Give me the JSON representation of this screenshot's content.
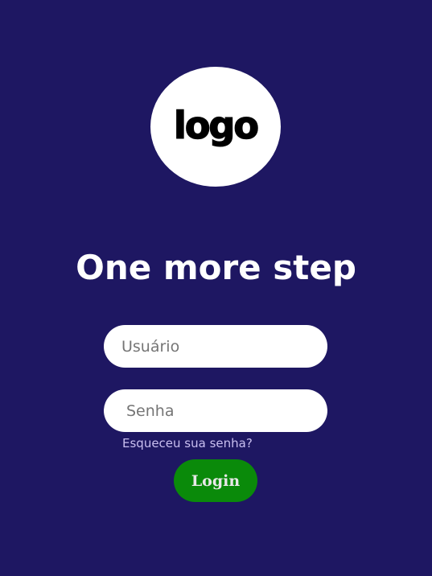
{
  "logo": {
    "text": "logo"
  },
  "title": "One more step",
  "form": {
    "username_placeholder": "Usuário",
    "username_value": "",
    "password_placeholder": "Senha",
    "password_value": "",
    "forgot_label": "Esqueceu sua senha?",
    "login_label": "Login"
  },
  "colors": {
    "background": "#1e1762",
    "login_button": "#0a8a0a",
    "forgot_link": "#c9bff0"
  }
}
